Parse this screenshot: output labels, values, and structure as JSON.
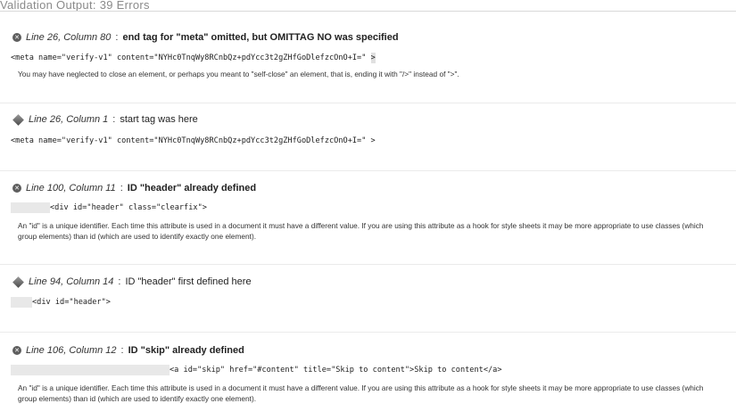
{
  "page": {
    "title": "Validation Output: 39 Errors"
  },
  "entries": [
    {
      "kind": "error",
      "icon": "error-circle-icon",
      "location": "Line 26, Column 80",
      "separator": ":",
      "message": "end tag for \"meta\" omitted, but OMITTAG NO was specified",
      "code": "<meta name=\"verify-v1\" content=\"NYHc0TnqWy8RCnbQz+pdYcc3t2gZHfGoDlefzcOnO+I=\" ",
      "code_mark": ">",
      "note": "You may have neglected to close an element, or perhaps you meant to \"self-close\" an element, that is, ending it with \"/>\" instead of \">\"."
    },
    {
      "kind": "info",
      "icon": "info-diamond-icon",
      "location": "Line 26, Column 1",
      "separator": ":",
      "message": "start tag was here",
      "code": "<meta name=\"verify-v1\" content=\"NYHc0TnqWy8RCnbQz+pdYcc3t2gZHfGoDlefzcOnO+I=\" >"
    },
    {
      "kind": "error",
      "icon": "error-circle-icon",
      "location": "Line 100, Column 11",
      "separator": ":",
      "message": "ID \"header\" already defined",
      "code": "<div id=\"header\" class=\"clearfix\">",
      "note": "An \"id\" is a unique identifier. Each time this attribute is used in a document it must have a different value. If you are using this attribute as a hook for style sheets it may be more appropriate to use classes (which group elements) than id (which are used to identify exactly one element)."
    },
    {
      "kind": "info",
      "icon": "info-diamond-icon",
      "location": "Line 94, Column 14",
      "separator": ":",
      "message": "ID \"header\" first defined here",
      "code": "<div id=\"header\">"
    },
    {
      "kind": "error",
      "icon": "error-circle-icon",
      "location": "Line 106, Column 12",
      "separator": ":",
      "message": "ID \"skip\" already defined",
      "code": "<a id=\"skip\" href=\"#content\" title=\"Skip to content\">Skip to content</a>",
      "note": "An \"id\" is a unique identifier. Each time this attribute is used in a document it must have a different value. If you are using this attribute as a hook for style sheets it may be more appropriate to use classes (which group elements) than id (which are used to identify exactly one element)."
    }
  ]
}
